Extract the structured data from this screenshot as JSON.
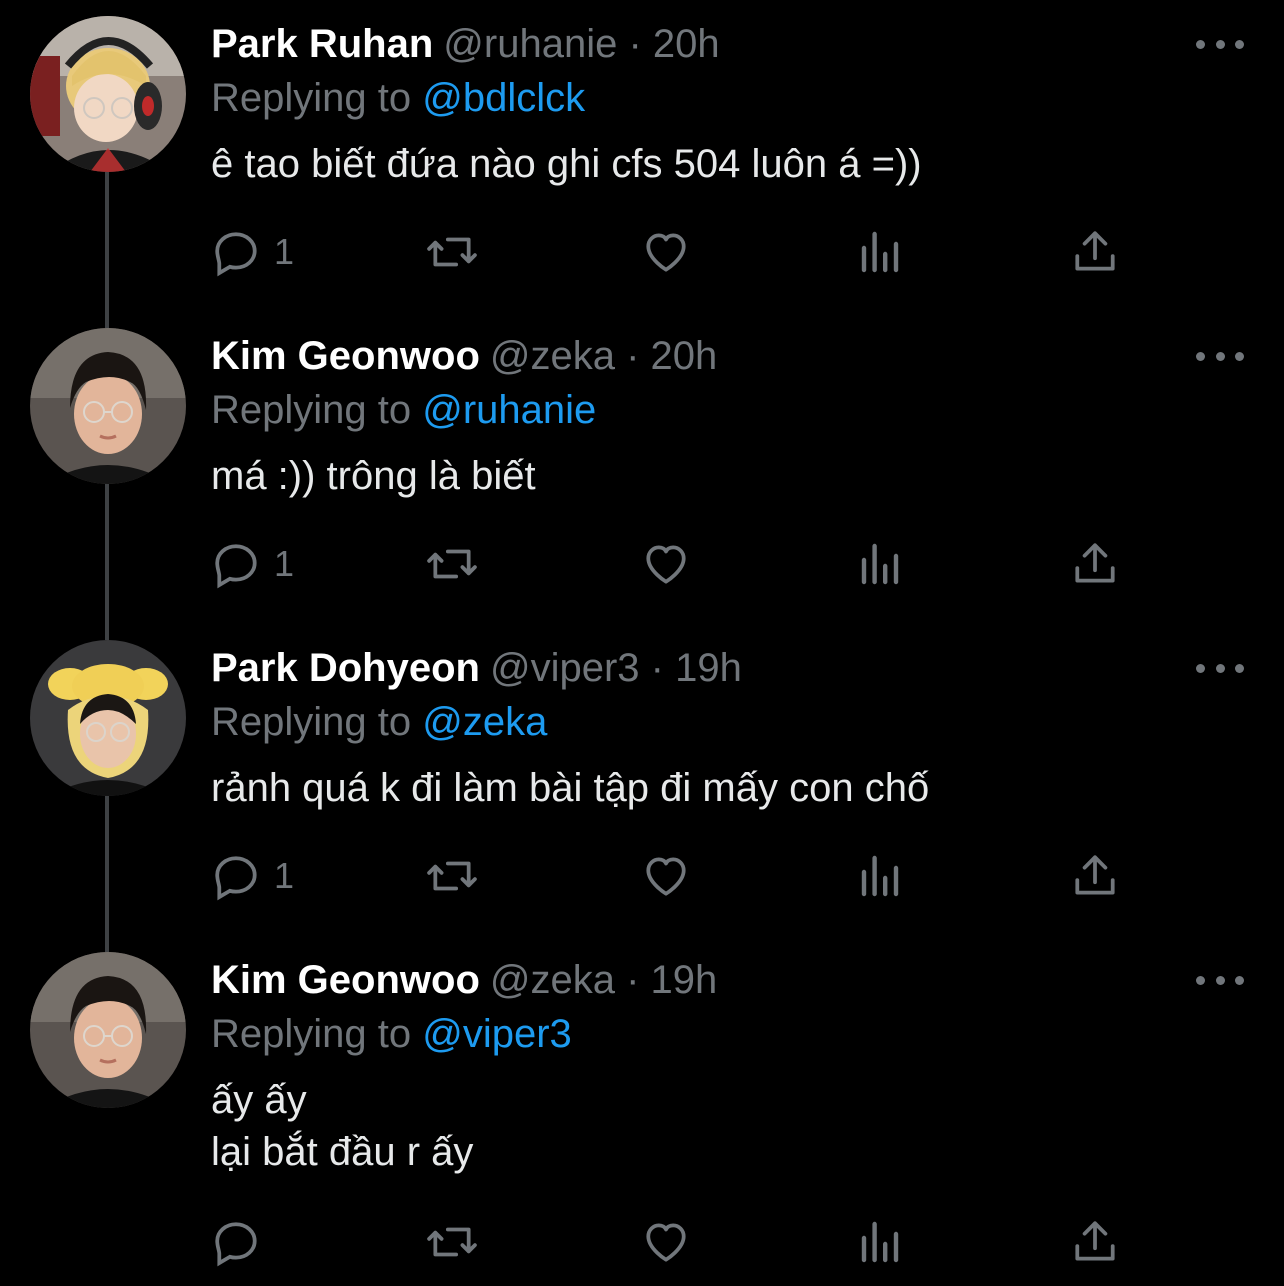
{
  "tweets": [
    {
      "name": "Park Ruhan",
      "handle": "@ruhanie",
      "time": "· 20h",
      "reply_prefix": "Replying to",
      "reply_to": "@bdlclck",
      "text": "ê tao biết đứa nào ghi cfs 504 luôn á =))",
      "reply_count": "1",
      "avatar": "avatar-blonde-headset"
    },
    {
      "name": "Kim Geonwoo",
      "handle": "@zeka",
      "time": "· 20h",
      "reply_prefix": "Replying to",
      "reply_to": "@ruhanie",
      "text": "má :)) trông là biết",
      "reply_count": "1",
      "avatar": "avatar-dark-hair-glasses"
    },
    {
      "name": "Park Dohyeon",
      "handle": "@viper3",
      "time": "· 19h",
      "reply_prefix": "Replying to",
      "reply_to": "@zeka",
      "text": "rảnh quá k đi làm bài tập đi mấy con chố",
      "reply_count": "1",
      "avatar": "avatar-yellow-hat"
    },
    {
      "name": "Kim Geonwoo",
      "handle": "@zeka",
      "time": "· 19h",
      "reply_prefix": "Replying to",
      "reply_to": "@viper3",
      "text": "ấy ấy\nlại bắt đầu r ấy",
      "reply_count": "",
      "avatar": "avatar-dark-hair-glasses"
    }
  ],
  "icons": {
    "reply": "reply-icon",
    "retweet": "retweet-icon",
    "like": "heart-icon",
    "views": "views-icon",
    "share": "share-icon",
    "more": "more-icon"
  },
  "colors": {
    "background": "#000000",
    "name": "#ffffff",
    "secondary": "#71767b",
    "mention": "#1d9bf0",
    "body": "#e7e9ea",
    "thread": "#3e4144"
  }
}
